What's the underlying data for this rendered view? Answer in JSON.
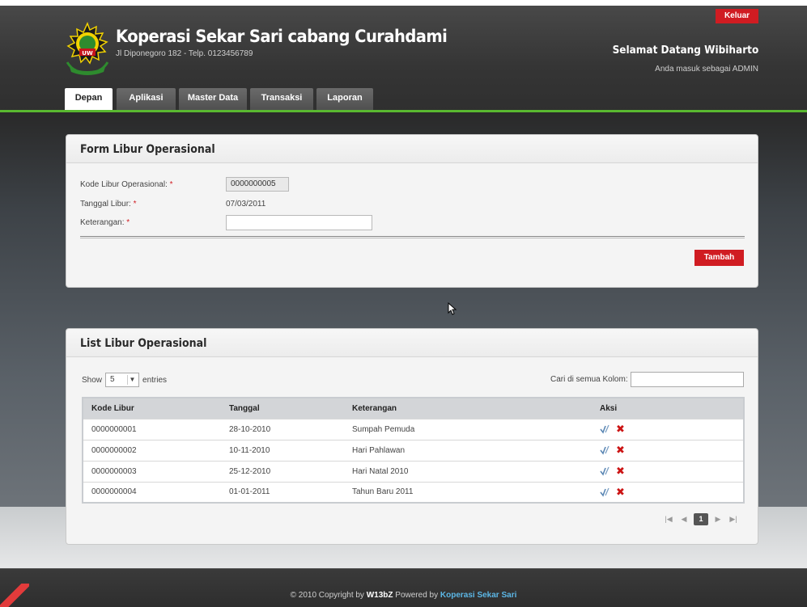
{
  "header": {
    "title": "Koperasi Sekar Sari cabang Curahdami",
    "address": "Jl Diponegoro 182 - Telp. 0123456789",
    "logout_label": "Keluar",
    "welcome": "Selamat Datang Wibiharto",
    "role": "Anda masuk sebagai ADMIN",
    "nav": [
      "Depan",
      "Aplikasi",
      "Master Data",
      "Transaksi",
      "Laporan"
    ],
    "active_nav": "Depan"
  },
  "form": {
    "title": "Form Libur Operasional",
    "kode_label": "Kode Libur Operasional:",
    "kode_value": "0000000005",
    "tanggal_label": "Tanggal Libur:",
    "tanggal_value": "07/03/2011",
    "keterangan_label": "Keterangan:",
    "keterangan_value": "",
    "required_mark": "*",
    "submit_label": "Tambah"
  },
  "list": {
    "title": "List Libur Operasional",
    "show_label": "Show",
    "entries_value": "5",
    "entries_label": "entries",
    "search_label": "Cari di semua Kolom:",
    "columns": [
      "Kode Libur",
      "Tanggal",
      "Keterangan",
      "Aksi"
    ],
    "rows": [
      [
        "0000000001",
        "28-10-2010",
        "Sumpah Pemuda"
      ],
      [
        "0000000002",
        "10-11-2010",
        "Hari Pahlawan"
      ],
      [
        "0000000003",
        "25-12-2010",
        "Hari Natal 2010"
      ],
      [
        "0000000004",
        "01-01-2011",
        "Tahun Baru 2011"
      ]
    ],
    "current_page": "1"
  },
  "footer": {
    "prefix": "© 2010 Copyright by",
    "author": "W13bZ",
    "powered": "Powered by",
    "brand": "Koperasi Sekar Sari"
  },
  "colors": {
    "accent_red": "#d01c22",
    "accent_green": "#59b830",
    "footer_link": "#5cb7e6"
  },
  "icons": {
    "edit": "checkmark-pen-icon",
    "delete": "red-x-icon",
    "pagination": [
      "first-page-icon",
      "prev-page-icon",
      "next-page-icon",
      "last-page-icon"
    ]
  }
}
